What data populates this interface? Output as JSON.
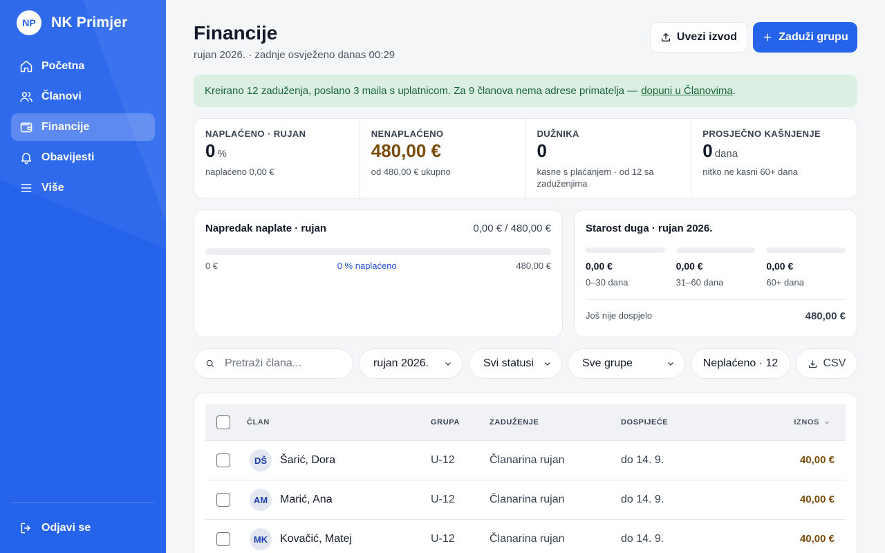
{
  "brand": {
    "initials": "NP",
    "name": "NK Primjer"
  },
  "sidebar": {
    "items": [
      {
        "label": "Početna",
        "icon": "home-icon"
      },
      {
        "label": "Članovi",
        "icon": "users-icon"
      },
      {
        "label": "Financije",
        "icon": "wallet-icon",
        "active": true
      },
      {
        "label": "Obavijesti",
        "icon": "bell-icon"
      },
      {
        "label": "Više",
        "icon": "menu-icon"
      }
    ],
    "logout": {
      "label": "Odjavi se",
      "icon": "logout-icon"
    }
  },
  "header": {
    "title": "Financije",
    "subtitle": "rujan 2026. · zadnje osvježeno danas 00:29",
    "upload_label": "Uvezi izvod",
    "primary_label": "Zaduži grupu"
  },
  "alert": {
    "text": "Kreirano 12 zaduženja, poslano 3 maila s uplatnicom. Za 9 članova nema adrese primatelja —",
    "link": "dopuni u Članovima",
    "tail": "."
  },
  "stats": [
    {
      "label": "NAPLAĆENO · RUJAN",
      "value": "0",
      "unit": "%",
      "note": "naplaćeno 0,00 €"
    },
    {
      "label": "NENAPLAĆENO",
      "value": "480,00 €",
      "unit": "",
      "note": "od 480,00 € ukupno"
    },
    {
      "label": "DUŽNIKA",
      "value": "0",
      "unit": "",
      "note": "kasne s plaćanjem · od 12 sa zaduženjima"
    },
    {
      "label": "PROSJEČNO KAŠNJENJE",
      "value": "0",
      "unit": "dana",
      "note": "nitko ne kasni 60+ dana"
    }
  ],
  "progress": {
    "title": "Napredak naplate · rujan",
    "meta": "0,00 € / 480,00 €",
    "fraction": 0,
    "min_label": "0 €",
    "mid_label": "0 % naplaćeno",
    "max_label": "480,00 €"
  },
  "aging": {
    "title": "Starost duga · rujan 2026.",
    "buckets": [
      {
        "value": "0,00 €",
        "label": "0–30 dana"
      },
      {
        "value": "0,00 €",
        "label": "31–60 dana"
      },
      {
        "value": "0,00 €",
        "label": "60+ dana"
      }
    ],
    "foot_label": "Još nije dospjelo",
    "foot_value": "480,00 €"
  },
  "filters": {
    "search_placeholder": "Pretraži člana...",
    "month": "rujan 2026.",
    "status": "Svi statusi",
    "group": "Sve grupe",
    "toggle": "Neplaćeno · 12",
    "csv": "CSV"
  },
  "table": {
    "headers": {
      "member": "ČLAN",
      "group": "GRUPA",
      "charge": "ZADUŽENJE",
      "due": "DOSPIJEĆE",
      "amount": "IZNOS"
    },
    "rows": [
      {
        "initials": "DŠ",
        "name": "Šarić, Dora",
        "group": "U-12",
        "charge": "Članarina rujan",
        "due": "do 14. 9.",
        "amount": "40,00 €"
      },
      {
        "initials": "AM",
        "name": "Marić, Ana",
        "group": "U-12",
        "charge": "Članarina rujan",
        "due": "do 14. 9.",
        "amount": "40,00 €"
      },
      {
        "initials": "MK",
        "name": "Kovačić, Matej",
        "group": "U-12",
        "charge": "Članarina rujan",
        "due": "do 14. 9.",
        "amount": "40,00 €"
      }
    ]
  }
}
